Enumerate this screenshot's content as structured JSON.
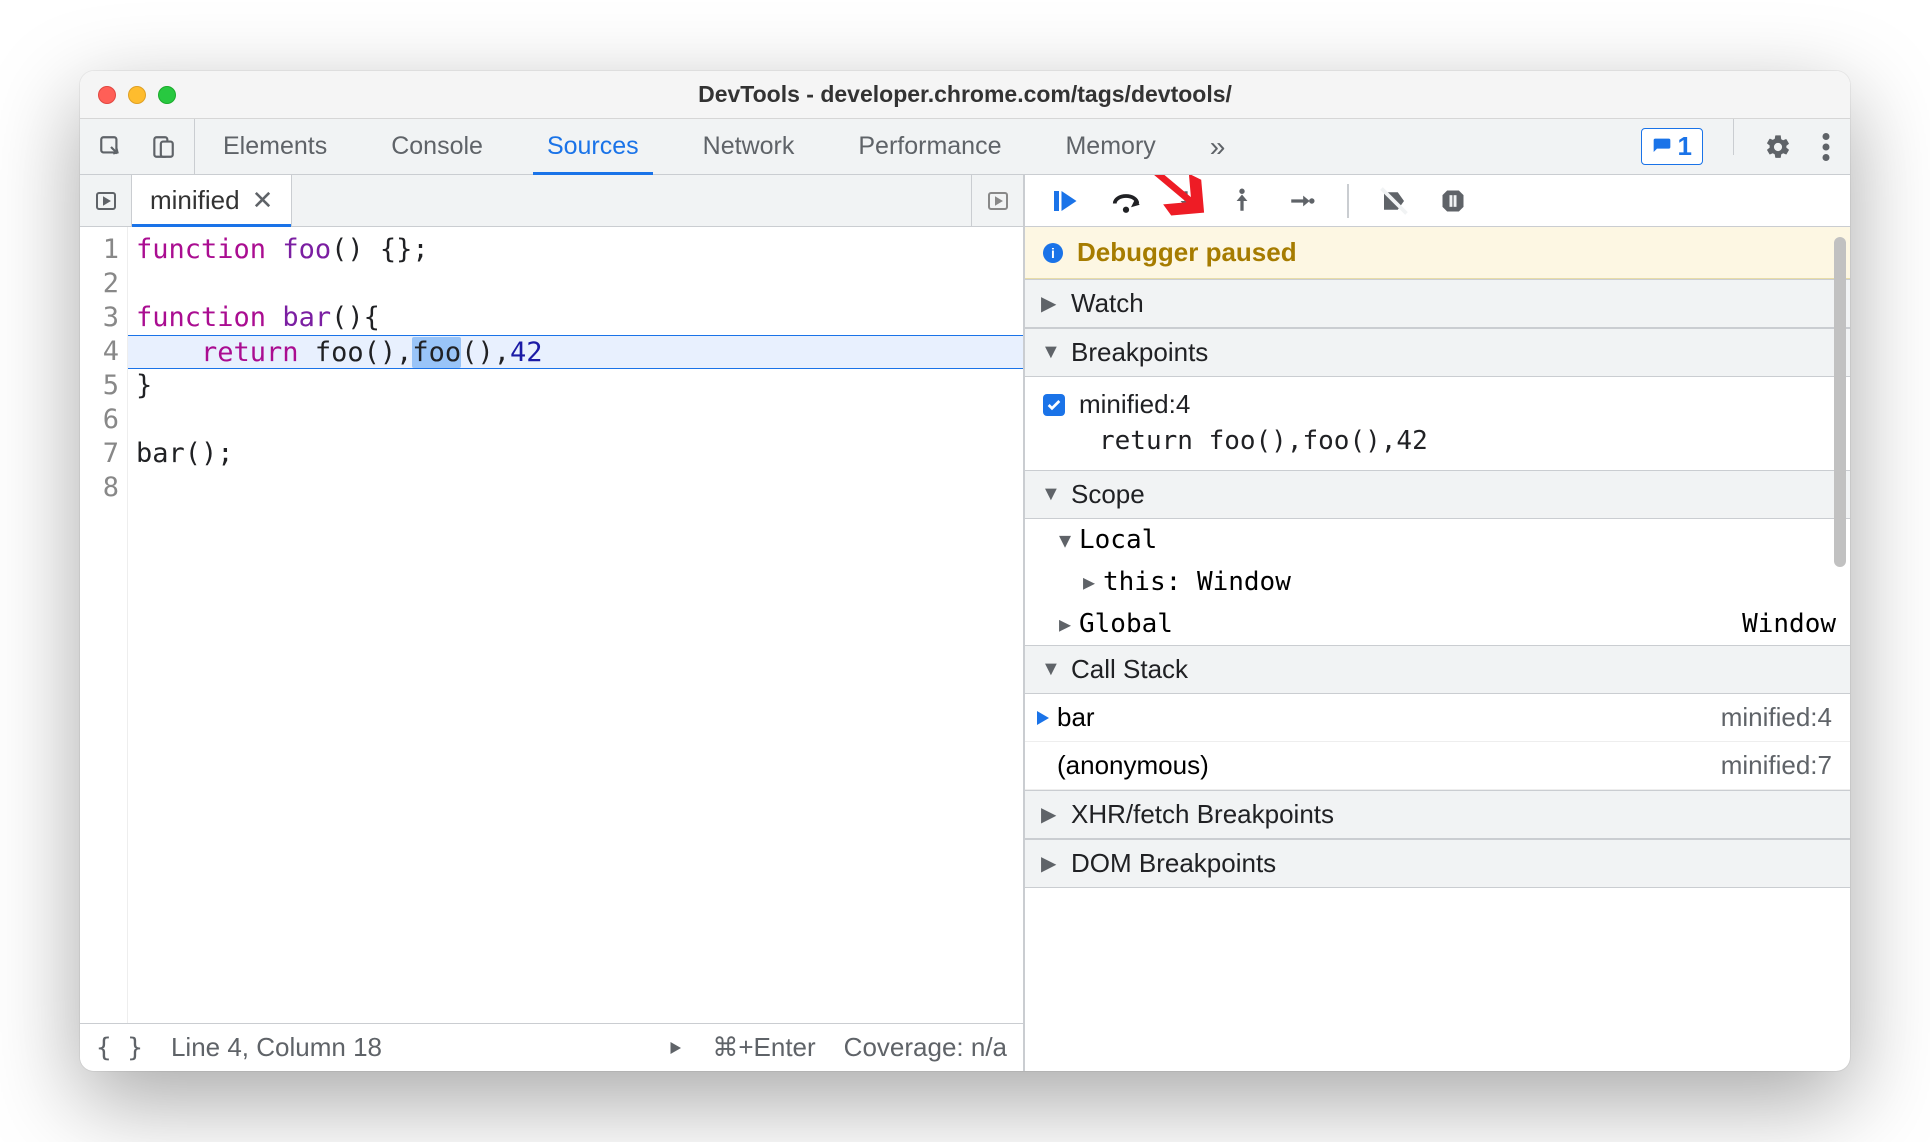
{
  "window": {
    "title": "DevTools - developer.chrome.com/tags/devtools/"
  },
  "toolbar": {
    "tabs": [
      "Elements",
      "Console",
      "Sources",
      "Network",
      "Performance",
      "Memory"
    ],
    "active_tab": "Sources",
    "issues_count": "1"
  },
  "file_tab": {
    "name": "minified"
  },
  "editor": {
    "line_count": 8,
    "lines": {
      "l1": {
        "kw": "function",
        "fn": "foo",
        "rest": "() {};"
      },
      "l3": {
        "kw": "function",
        "fn": "bar",
        "rest": "(){"
      },
      "l4": {
        "ret": "return",
        "c1": "foo",
        "p1": "(),",
        "c2": "foo",
        "p2": "(),",
        "num": "42"
      },
      "l5": "}",
      "l7": {
        "fn": "bar",
        "rest": "();"
      }
    }
  },
  "status": {
    "line_col": "Line 4, Column 18",
    "run_hint": "⌘+Enter",
    "coverage": "Coverage: n/a"
  },
  "debugger": {
    "paused_label": "Debugger paused",
    "sections": {
      "watch": "Watch",
      "breakpoints": "Breakpoints",
      "scope": "Scope",
      "callstack": "Call Stack",
      "xhr": "XHR/fetch Breakpoints",
      "dom": "DOM Breakpoints"
    },
    "breakpoint": {
      "label": "minified:4",
      "code": "return foo(),foo(),42"
    },
    "scope": {
      "local": "Local",
      "this_label": "this",
      "this_value": "Window",
      "global": "Global",
      "global_value": "Window"
    },
    "callstack": [
      {
        "name": "bar",
        "loc": "minified:4",
        "current": true
      },
      {
        "name": "(anonymous)",
        "loc": "minified:7",
        "current": false
      }
    ]
  }
}
